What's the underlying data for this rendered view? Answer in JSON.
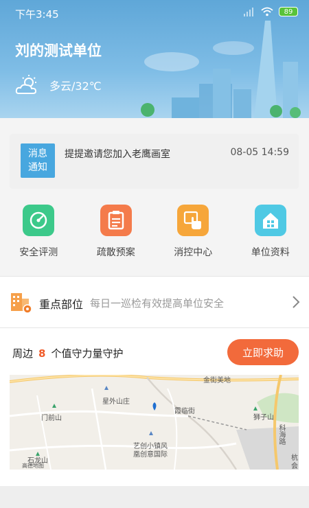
{
  "status": {
    "time": "下午3:45",
    "battery": "89"
  },
  "header": {
    "unit_name": "刘的测试单位",
    "weather": "多云/32℃"
  },
  "notice": {
    "badge_line1": "消息",
    "badge_line2": "通知",
    "message": "提提邀请您加入老鹰画室",
    "time": "08-05 14:59"
  },
  "actions": [
    {
      "label": "安全评测",
      "icon": "gauge-icon",
      "color": "#3cc98a"
    },
    {
      "label": "疏散预案",
      "icon": "document-icon",
      "color": "#f47b4b"
    },
    {
      "label": "消控中心",
      "icon": "touch-icon",
      "color": "#f6a63a"
    },
    {
      "label": "单位资料",
      "icon": "home-icon",
      "color": "#4fc9e4"
    }
  ],
  "key_area": {
    "title": "重点部位",
    "description": "每日一巡检有效提高单位安全"
  },
  "nearby": {
    "prefix": "周边",
    "count": "8",
    "suffix": "个值守力量守护",
    "help_button": "立即求助"
  },
  "map": {
    "labels": [
      "金街美地",
      "星外山庄",
      "霞临街",
      "门前山",
      "狮子山",
      "艺创小镇风",
      "凰创意国际",
      "石龙山",
      "高德地图",
      "科海路",
      "杭",
      "会"
    ]
  },
  "colors": {
    "accent": "#f26a3b",
    "notice_badge": "#48a7df",
    "count": "#f05a28"
  }
}
